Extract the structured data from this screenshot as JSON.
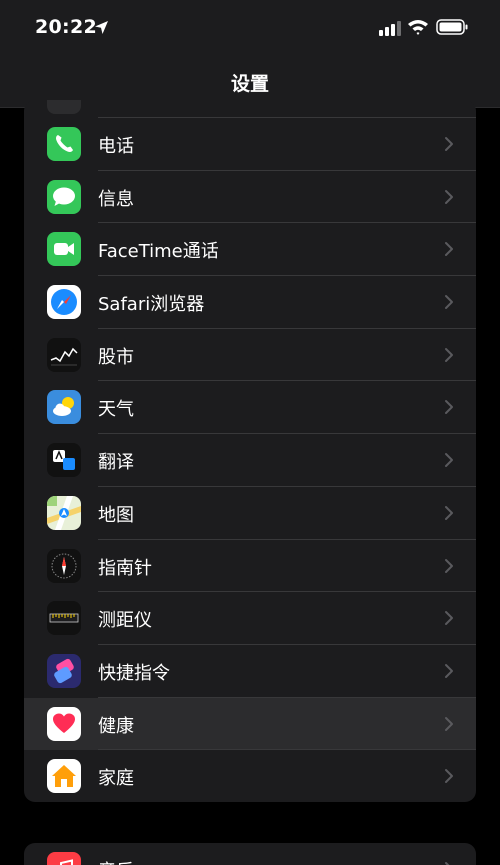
{
  "status": {
    "time": "20:22"
  },
  "nav": {
    "title": "设置"
  },
  "rows": [
    {
      "label": "电话",
      "icon": "phone-icon"
    },
    {
      "label": "信息",
      "icon": "messages-icon"
    },
    {
      "label": "FaceTime通话",
      "icon": "facetime-icon"
    },
    {
      "label": "Safari浏览器",
      "icon": "safari-icon"
    },
    {
      "label": "股市",
      "icon": "stocks-icon"
    },
    {
      "label": "天气",
      "icon": "weather-icon"
    },
    {
      "label": "翻译",
      "icon": "translate-icon"
    },
    {
      "label": "地图",
      "icon": "maps-icon"
    },
    {
      "label": "指南针",
      "icon": "compass-icon"
    },
    {
      "label": "测距仪",
      "icon": "measure-icon"
    },
    {
      "label": "快捷指令",
      "icon": "shortcuts-icon"
    },
    {
      "label": "健康",
      "icon": "health-icon"
    },
    {
      "label": "家庭",
      "icon": "home-icon"
    }
  ],
  "bottom_rows": [
    {
      "label": "音乐",
      "icon": "music-icon"
    }
  ],
  "colors": {
    "highlight": "#2c2c2e",
    "group_bg": "#1c1c1e",
    "separator": "#38383a",
    "chevron": "#5a5a5e"
  }
}
